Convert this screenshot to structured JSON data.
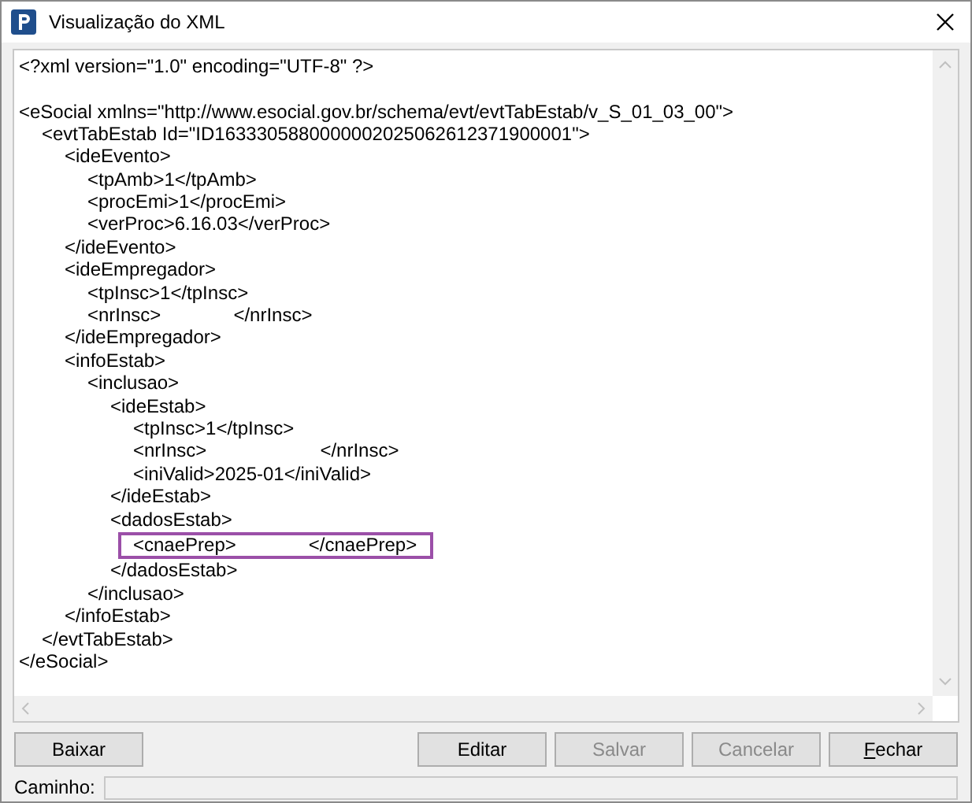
{
  "window": {
    "title": "Visualização do XML"
  },
  "xml": {
    "declaration": "<?xml version=\"1.0\" encoding=\"UTF-8\" ?>",
    "root": {
      "open": "<eSocial xmlns=\"http://www.esocial.gov.br/schema/evt/evtTabEstab/v_S_01_03_00\">",
      "close": "</eSocial>",
      "highlighted": false,
      "children": [
        {
          "open": "<evtTabEstab Id=\"ID1633305880000002025062612371900001\">",
          "close": "</evtTabEstab>",
          "highlighted": false,
          "children": [
            {
              "open": "<ideEvento>",
              "close": "</ideEvento>",
              "highlighted": false,
              "children": [
                {
                  "kind": "text",
                  "text": "<tpAmb>1</tpAmb>",
                  "highlighted": false
                },
                {
                  "kind": "text",
                  "text": "<procEmi>1</procEmi>",
                  "highlighted": false
                },
                {
                  "kind": "text",
                  "text": "<verProc>6.16.03</verProc>",
                  "highlighted": false
                }
              ]
            },
            {
              "open": "<ideEmpregador>",
              "close": "</ideEmpregador>",
              "highlighted": false,
              "children": [
                {
                  "kind": "text",
                  "text": "<tpInsc>1</tpInsc>",
                  "highlighted": false
                },
                {
                  "kind": "redacted",
                  "start": "<nrInsc>",
                  "end": "</nrInsc>",
                  "highlighted": false
                }
              ]
            },
            {
              "open": "<infoEstab>",
              "close": "</infoEstab>",
              "highlighted": false,
              "children": [
                {
                  "open": "<inclusao>",
                  "close": "</inclusao>",
                  "highlighted": false,
                  "children": [
                    {
                      "open": "<ideEstab>",
                      "close": "</ideEstab>",
                      "highlighted": false,
                      "children": [
                        {
                          "kind": "text",
                          "text": "<tpInsc>1</tpInsc>",
                          "highlighted": false
                        },
                        {
                          "kind": "redacted_long",
                          "start": "<nrInsc>",
                          "end": "</nrInsc>",
                          "highlighted": false
                        },
                        {
                          "kind": "text",
                          "text": "<iniValid>2025-01</iniValid>",
                          "highlighted": false
                        }
                      ]
                    },
                    {
                      "open": "<dadosEstab>",
                      "close": "</dadosEstab>",
                      "highlighted": false,
                      "children": [
                        {
                          "kind": "redacted",
                          "start": "<cnaePrep>",
                          "end": "</cnaePrep>",
                          "highlighted": true
                        }
                      ]
                    }
                  ]
                }
              ]
            }
          ]
        }
      ]
    }
  },
  "buttons": [
    {
      "label": "Baixar",
      "disabled": false,
      "mnemonic": false
    },
    {
      "label": "Editar",
      "disabled": false,
      "mnemonic": false
    },
    {
      "label": "Salvar",
      "disabled": true,
      "mnemonic": false
    },
    {
      "label": "Cancelar",
      "disabled": true,
      "mnemonic": false
    },
    {
      "label": "Fechar",
      "disabled": false,
      "mnemonic": true
    }
  ],
  "path_field": {
    "label": "Caminho:"
  }
}
